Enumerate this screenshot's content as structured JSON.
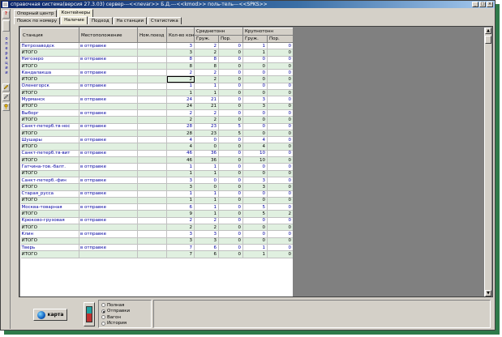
{
  "window": {
    "title": "справочная система(версия 27.3.03) сервер---<<nevar>> Б.Д.---<<kmod>> поль-тель---<<SPKS>>",
    "min": "_",
    "max": "□",
    "close": "×"
  },
  "left_toolbar": {
    "help": "?",
    "vertical_text": "о\nп\nе\nр\nа\nц\nи\nи"
  },
  "tabs_top": [
    {
      "label": "Опорный центр",
      "active": false
    },
    {
      "label": "Контейнеры",
      "active": true
    }
  ],
  "tabs_sub": [
    {
      "label": "Поиск по номеру",
      "active": false
    },
    {
      "label": "Наличие",
      "active": true
    },
    {
      "label": "Подход",
      "active": false
    },
    {
      "label": "На станции",
      "active": false
    },
    {
      "label": "Статистика",
      "active": false
    }
  ],
  "grid": {
    "headers": {
      "station": "Станция",
      "location": "Местоположение",
      "train_num": "Ном.поезд",
      "count_cont": "Кол-во конт",
      "medium": "Среднетонн",
      "large": "Крупнотонн",
      "loaded": "Груж.",
      "empty": "Пор."
    },
    "rows": [
      {
        "type": "data",
        "station": "Петрозаводск",
        "location": "в отправке",
        "train": "",
        "count": "3",
        "m_l": "2",
        "m_e": "0",
        "l_l": "1",
        "l_e": "0"
      },
      {
        "type": "total",
        "station": "ИТОГО",
        "location": "",
        "train": "",
        "count": "3",
        "m_l": "2",
        "m_e": "0",
        "l_l": "1",
        "l_e": "0"
      },
      {
        "type": "data",
        "station": "Нигозеро",
        "location": "в отправке",
        "train": "",
        "count": "8",
        "m_l": "8",
        "m_e": "0",
        "l_l": "0",
        "l_e": "0"
      },
      {
        "type": "total",
        "station": "ИТОГО",
        "location": "",
        "train": "",
        "count": "8",
        "m_l": "8",
        "m_e": "0",
        "l_l": "0",
        "l_e": "0"
      },
      {
        "type": "data",
        "station": "Кандалакша",
        "location": "в отправке",
        "train": "",
        "count": "2",
        "m_l": "2",
        "m_e": "0",
        "l_l": "0",
        "l_e": "0"
      },
      {
        "type": "total",
        "station": "ИТОГО",
        "location": "",
        "train": "",
        "count": "2",
        "m_l": "2",
        "m_e": "0",
        "l_l": "0",
        "l_e": "0",
        "selected": true
      },
      {
        "type": "data",
        "station": "Оленегорск",
        "location": "в отправке",
        "train": "",
        "count": "1",
        "m_l": "1",
        "m_e": "0",
        "l_l": "0",
        "l_e": "0"
      },
      {
        "type": "total",
        "station": "ИТОГО",
        "location": "",
        "train": "",
        "count": "1",
        "m_l": "1",
        "m_e": "0",
        "l_l": "0",
        "l_e": "0"
      },
      {
        "type": "data",
        "station": "Мурманск",
        "location": "в отправке",
        "train": "",
        "count": "24",
        "m_l": "21",
        "m_e": "0",
        "l_l": "3",
        "l_e": "0"
      },
      {
        "type": "total",
        "station": "ИТОГО",
        "location": "",
        "train": "",
        "count": "24",
        "m_l": "21",
        "m_e": "0",
        "l_l": "3",
        "l_e": "0"
      },
      {
        "type": "data",
        "station": "Выборг",
        "location": "в отправке",
        "train": "",
        "count": "2",
        "m_l": "2",
        "m_e": "0",
        "l_l": "0",
        "l_e": "0"
      },
      {
        "type": "total",
        "station": "ИТОГО",
        "location": "",
        "train": "",
        "count": "2",
        "m_l": "2",
        "m_e": "0",
        "l_l": "0",
        "l_e": "0"
      },
      {
        "type": "data",
        "station": "Санкт-петерб.тв-нос",
        "location": "в отправке",
        "train": "",
        "count": "28",
        "m_l": "23",
        "m_e": "5",
        "l_l": "0",
        "l_e": "0"
      },
      {
        "type": "total",
        "station": "ИТОГО",
        "location": "",
        "train": "",
        "count": "28",
        "m_l": "23",
        "m_e": "5",
        "l_l": "0",
        "l_e": "0"
      },
      {
        "type": "data",
        "station": "Шушары",
        "location": "в отправке",
        "train": "",
        "count": "4",
        "m_l": "0",
        "m_e": "0",
        "l_l": "4",
        "l_e": "0"
      },
      {
        "type": "total",
        "station": "ИТОГО",
        "location": "",
        "train": "",
        "count": "4",
        "m_l": "0",
        "m_e": "0",
        "l_l": "4",
        "l_e": "0"
      },
      {
        "type": "data",
        "station": "Санкт-петерб.тв-вит",
        "location": "в отправке",
        "train": "",
        "count": "46",
        "m_l": "36",
        "m_e": "0",
        "l_l": "10",
        "l_e": "0"
      },
      {
        "type": "total",
        "station": "ИТОГО",
        "location": "",
        "train": "",
        "count": "46",
        "m_l": "36",
        "m_e": "0",
        "l_l": "10",
        "l_e": "0"
      },
      {
        "type": "data",
        "station": "Гатчина-тов.-балт.",
        "location": "в отправке",
        "train": "",
        "count": "1",
        "m_l": "1",
        "m_e": "0",
        "l_l": "0",
        "l_e": "0"
      },
      {
        "type": "total",
        "station": "ИТОГО",
        "location": "",
        "train": "",
        "count": "1",
        "m_l": "1",
        "m_e": "0",
        "l_l": "0",
        "l_e": "0"
      },
      {
        "type": "data",
        "station": "Санкт-петерб.-фин",
        "location": "в отправке",
        "train": "",
        "count": "3",
        "m_l": "0",
        "m_e": "0",
        "l_l": "3",
        "l_e": "0"
      },
      {
        "type": "total",
        "station": "ИТОГО",
        "location": "",
        "train": "",
        "count": "3",
        "m_l": "0",
        "m_e": "0",
        "l_l": "3",
        "l_e": "0"
      },
      {
        "type": "data",
        "station": "Старая_русса",
        "location": "в отправке",
        "train": "",
        "count": "1",
        "m_l": "1",
        "m_e": "0",
        "l_l": "0",
        "l_e": "0"
      },
      {
        "type": "total",
        "station": "ИТОГО",
        "location": "",
        "train": "",
        "count": "1",
        "m_l": "1",
        "m_e": "0",
        "l_l": "0",
        "l_e": "0"
      },
      {
        "type": "data",
        "station": "Москва-товарная",
        "location": "в отправке",
        "train": "",
        "count": "6",
        "m_l": "1",
        "m_e": "0",
        "l_l": "5",
        "l_e": "0"
      },
      {
        "type": "total",
        "station": "ИТОГО",
        "location": "",
        "train": "",
        "count": "9",
        "m_l": "1",
        "m_e": "0",
        "l_l": "5",
        "l_e": "2"
      },
      {
        "type": "data",
        "station": "Крюково-грузовая",
        "location": "в отправке",
        "train": "",
        "count": "2",
        "m_l": "2",
        "m_e": "0",
        "l_l": "0",
        "l_e": "0"
      },
      {
        "type": "total",
        "station": "ИТОГО",
        "location": "",
        "train": "",
        "count": "2",
        "m_l": "2",
        "m_e": "0",
        "l_l": "0",
        "l_e": "0"
      },
      {
        "type": "data",
        "station": "Клин",
        "location": "в отправке",
        "train": "",
        "count": "3",
        "m_l": "3",
        "m_e": "0",
        "l_l": "0",
        "l_e": "0"
      },
      {
        "type": "total",
        "station": "ИТОГО",
        "location": "",
        "train": "",
        "count": "3",
        "m_l": "3",
        "m_e": "0",
        "l_l": "0",
        "l_e": "0"
      },
      {
        "type": "data",
        "station": "Тверь",
        "location": "в отправке",
        "train": "",
        "count": "7",
        "m_l": "6",
        "m_e": "0",
        "l_l": "1",
        "l_e": "0"
      },
      {
        "type": "total",
        "station": "ИТОГО",
        "location": "",
        "train": "",
        "count": "7",
        "m_l": "6",
        "m_e": "0",
        "l_l": "1",
        "l_e": "0"
      }
    ]
  },
  "scroll": {
    "up": "▲",
    "down": "▼"
  },
  "bottom": {
    "map_button": "карта",
    "radio_options": [
      {
        "label": "Полная",
        "checked": false
      },
      {
        "label": "Отправки",
        "checked": true
      },
      {
        "label": "Вагон",
        "checked": false
      },
      {
        "label": "История",
        "checked": false
      }
    ]
  },
  "colors": {
    "title_blue": "#0a246a",
    "total_row": "#e0f0e0",
    "data_text": "#0000a0",
    "outer_shadow": "#2f7a4a"
  }
}
